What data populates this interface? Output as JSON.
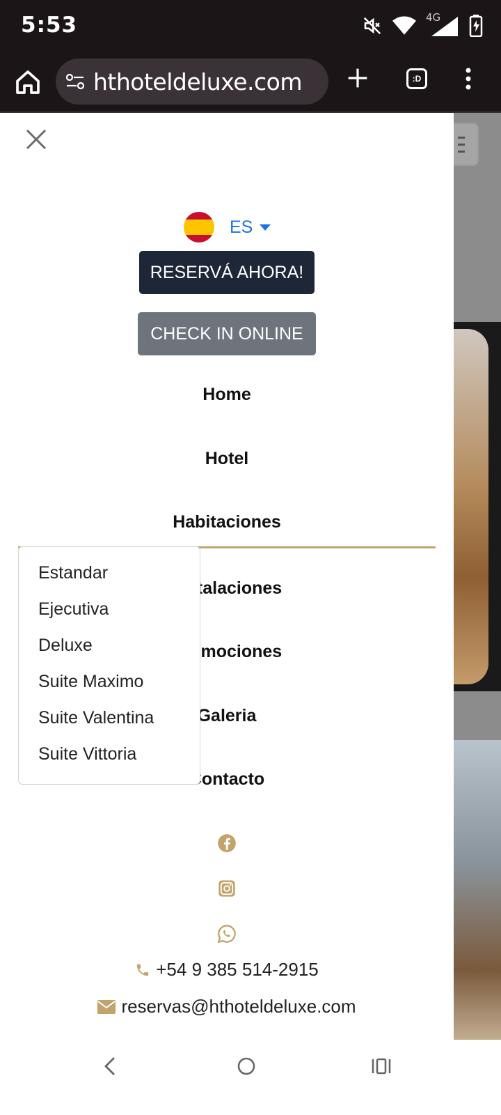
{
  "status": {
    "time": "5:53",
    "network": "4G"
  },
  "browser": {
    "url": "hthoteldeluxe.com",
    "tabs_label": ":D"
  },
  "menu": {
    "language": {
      "code": "ES"
    },
    "reserve_label": "RESERVÁ AHORA!",
    "checkin_label": "CHECK IN ONLINE",
    "nav": [
      {
        "label": "Home"
      },
      {
        "label": "Hotel"
      },
      {
        "label": "Habitaciones"
      },
      {
        "label": "Instalaciones"
      },
      {
        "label": "Promociones"
      },
      {
        "label": "Galeria"
      },
      {
        "label": "Contacto"
      }
    ],
    "rooms_dropdown": [
      {
        "label": "Estandar"
      },
      {
        "label": "Ejecutiva"
      },
      {
        "label": "Deluxe"
      },
      {
        "label": "Suite Maximo"
      },
      {
        "label": "Suite Valentina"
      },
      {
        "label": "Suite Vittoria"
      }
    ],
    "social": [
      "facebook-icon",
      "instagram-icon",
      "whatsapp-icon"
    ],
    "phone": "+54 9 385 514-2915",
    "email": "reservas@hthoteldeluxe.com"
  },
  "colors": {
    "accent_gold": "#c2a36b",
    "primary_dark": "#1e2738",
    "secondary_gray": "#6d747c",
    "link_blue": "#1a73e8"
  }
}
